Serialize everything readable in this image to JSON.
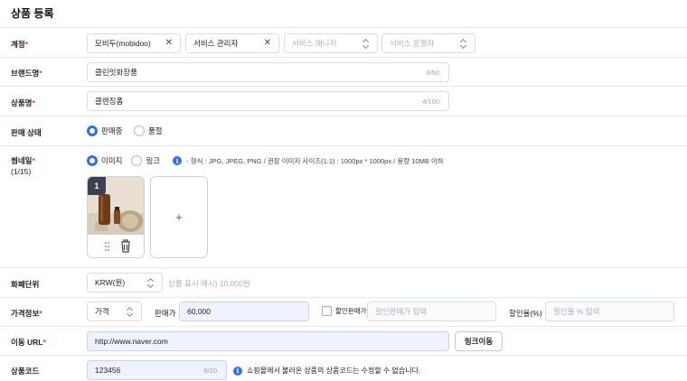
{
  "page_title": "상품 등록",
  "account": {
    "label": "계정",
    "required_mark": "*",
    "selected": "모비두(mobidoo)",
    "service_admin_value": "서비스 관리자",
    "service_manager_placeholder": "서비스 매니저",
    "service_operator_placeholder": "서비스 운영자"
  },
  "brand": {
    "label": "브랜드명",
    "required_mark": "*",
    "value": "클린잇화장품",
    "counter": "6/50"
  },
  "product_name": {
    "label": "상품명",
    "required_mark": "*",
    "value": "클렌징폼",
    "counter": "4/100"
  },
  "sale_status": {
    "label": "판매 상태",
    "options": [
      "판매중",
      "품절"
    ],
    "selected_index": 0
  },
  "thumbnail": {
    "label": "썸네일",
    "required_mark": "*",
    "count": "(1/15)",
    "options": [
      "이미지",
      "링크"
    ],
    "selected_index": 0,
    "hint": "- 형식 : JPG, JPEG, PNG / 권장 이미지 사이즈(1:1) : 1000px * 1000px / 용량 10MB 이하",
    "image_index": "1",
    "add_symbol": "+"
  },
  "currency": {
    "label": "화폐단위",
    "selected": "KRW(원)",
    "example_placeholder": "상품 표시 예시) 10,000원"
  },
  "price": {
    "label": "가격정보",
    "required_mark": "*",
    "type_selected": "가격",
    "sale_price_label": "판매가",
    "sale_price_value": "60,000",
    "discount_check_label": "할인판매가",
    "discount_price_placeholder": "할인판매가 입력",
    "discount_rate_label": "할인율(%)",
    "discount_rate_placeholder": "할인율 % 입력"
  },
  "url": {
    "label": "이동 URL",
    "required_mark": "*",
    "value": "http://www.naver.com",
    "button": "링크이동"
  },
  "code": {
    "label": "상품코드",
    "value": "123456",
    "counter": "6/20",
    "notice": "쇼핑몰에서 불러온 상품의 상품코드는 수정할 수 없습니다."
  },
  "colors": {
    "accent": "#2f6ff5",
    "required": "#e53935",
    "filled_bg": "#eef3ff"
  }
}
